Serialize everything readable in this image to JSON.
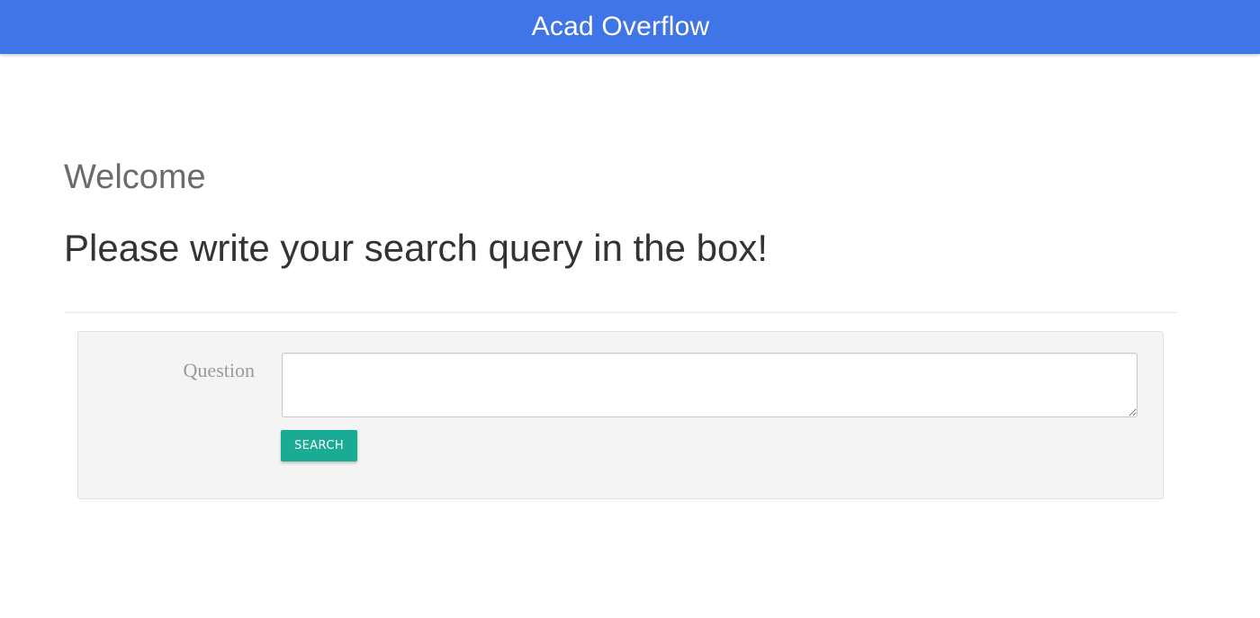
{
  "header": {
    "brand": "Acad Overflow",
    "background_color": "#4075e8"
  },
  "main": {
    "welcome": "Welcome",
    "lead": "Please write your search query in the box!"
  },
  "search_form": {
    "question_label": "Question",
    "question_value": "",
    "question_placeholder": "",
    "search_button_label": "SEARCH",
    "button_color": "#1aab94"
  }
}
